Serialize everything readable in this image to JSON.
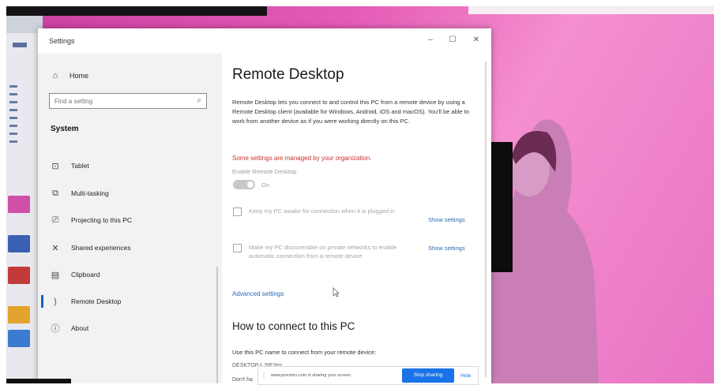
{
  "settings_window": {
    "title": "Settings",
    "controls": {
      "minimize": "–",
      "maximize": "☐",
      "close": "✕"
    }
  },
  "nav": {
    "home_label": "Home",
    "search_placeholder": "Find a setting",
    "section_title": "System",
    "items": [
      {
        "label": "Tablet",
        "icon": "tablet-icon",
        "glyph": "⊡"
      },
      {
        "label": "Multi-tasking",
        "icon": "multitasking-icon",
        "glyph": "⧉"
      },
      {
        "label": "Projecting to this PC",
        "icon": "projecting-icon",
        "glyph": "⎚"
      },
      {
        "label": "Shared experiences",
        "icon": "shared-experiences-icon",
        "glyph": "✕"
      },
      {
        "label": "Clipboard",
        "icon": "clipboard-icon",
        "glyph": "▤"
      },
      {
        "label": "Remote Desktop",
        "icon": "remote-desktop-icon",
        "glyph": "⟩",
        "active": true
      },
      {
        "label": "About",
        "icon": "about-icon",
        "glyph": "ⓘ"
      }
    ]
  },
  "content": {
    "title": "Remote Desktop",
    "description": "Remote Desktop lets you connect to and control this PC from a remote device by using a Remote Desktop client (available for Windows, Android, iOS and macOS). You'll be able to work from another device as if you were working directly on this PC.",
    "managed_notice": "Some settings are managed by your organization.",
    "enable_label": "Enable Remote Desktop",
    "toggle_state": "On",
    "option1": "Keep my PC awake for connection when it is plugged in",
    "option2": "Make my PC discoverable on private networks to enable automatic connection from a remote device",
    "show_settings": "Show settings",
    "advanced_settings": "Advanced settings",
    "how_to_title": "How to connect to this PC",
    "connect_desc": "Use this PC name to connect from your remote device:",
    "pc_name": "DESKTOP-LJ9E3en",
    "partial_text": "Don't ha"
  },
  "share_bar": {
    "handle": "⁞",
    "message": "www.proctoru.com is sharing your screen.",
    "stop_button": "Stop sharing",
    "hide_link": "Hide"
  },
  "colors": {
    "accent": "#0067c0",
    "link": "#2a6bb8",
    "warning": "#c4322f",
    "share_button": "#1a73e8",
    "background_pink": "#e45bb6"
  }
}
